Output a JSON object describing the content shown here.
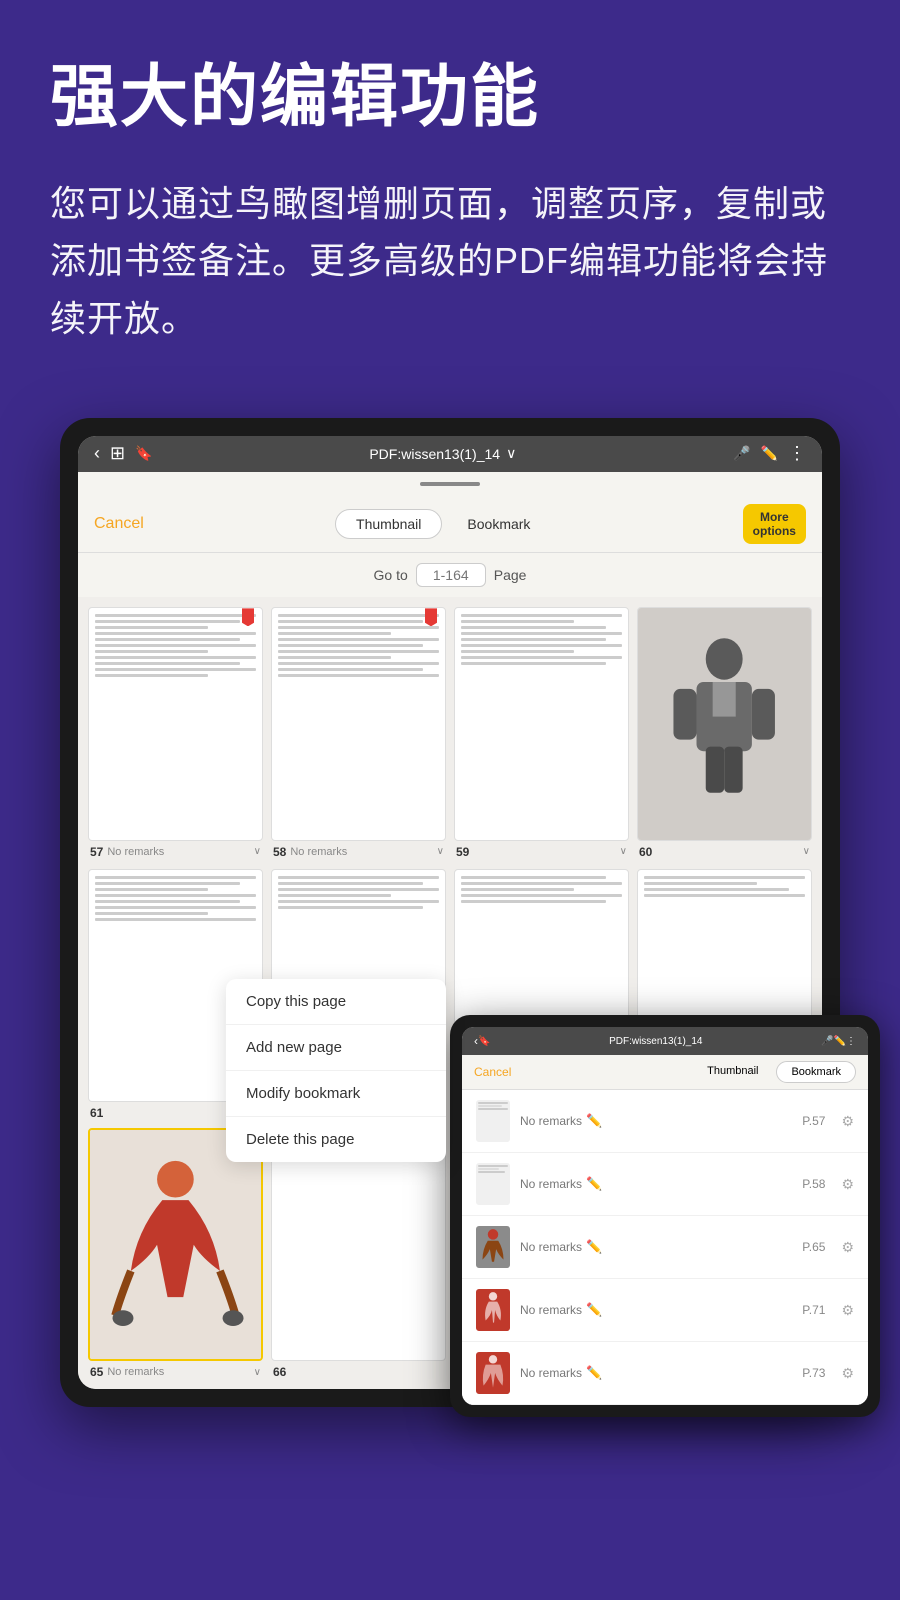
{
  "hero": {
    "title": "强大的编辑功能",
    "description": "您可以通过鸟瞰图增删页面，调整页序，复制或添加书签备注。更多高级的PDF编辑功能将会持续开放。"
  },
  "main_tablet": {
    "status_bar": {
      "back_icon": "←",
      "grid_icon": "⊞",
      "bookmark_icon": "🔖",
      "title": "PDF:wissen13(1)_14",
      "chevron": "∨",
      "mic_icon": "🎤",
      "pen_icon": "✏",
      "more_icon": "⋮"
    },
    "toolbar": {
      "cancel_label": "Cancel",
      "tab_thumbnail": "Thumbnail",
      "tab_bookmark": "Bookmark",
      "more_options": "More\noptions"
    },
    "goto": {
      "label": "Go to",
      "placeholder": "1-164",
      "page_label": "Page"
    },
    "pages": [
      {
        "num": "57",
        "remark": "No remarks",
        "has_bookmark": true
      },
      {
        "num": "58",
        "remark": "No remarks",
        "has_bookmark": true
      },
      {
        "num": "59",
        "remark": "",
        "has_bookmark": false
      },
      {
        "num": "60",
        "remark": "",
        "has_bookmark": false,
        "is_image": true
      },
      {
        "num": "61",
        "remark": "",
        "has_bookmark": false
      },
      {
        "num": "",
        "remark": "",
        "has_bookmark": false
      },
      {
        "num": "65",
        "remark": "No remarks",
        "has_bookmark": false
      },
      {
        "num": "66",
        "remark": "",
        "has_bookmark": false
      },
      {
        "num": "",
        "remark": "",
        "has_bookmark": false,
        "is_dancer": true
      }
    ],
    "context_menu": {
      "items": [
        "Copy this page",
        "Add new page",
        "Modify bookmark",
        "Delete this page"
      ]
    }
  },
  "overlay_tablet": {
    "title": "PDF:wissen13(1)_14",
    "toolbar": {
      "cancel": "Cancel",
      "tab_thumbnail": "Thumbnail",
      "tab_bookmark": "Bookmark"
    },
    "bookmarks": [
      {
        "page": "P.57",
        "remark": "No remarks",
        "type": "text"
      },
      {
        "page": "P.58",
        "remark": "No remarks",
        "type": "text"
      },
      {
        "page": "P.65",
        "remark": "No remarks",
        "type": "figure"
      },
      {
        "page": "P.71",
        "remark": "No remarks",
        "type": "red_figure"
      },
      {
        "page": "P.73",
        "remark": "No remarks",
        "type": "red_figure2"
      }
    ]
  }
}
